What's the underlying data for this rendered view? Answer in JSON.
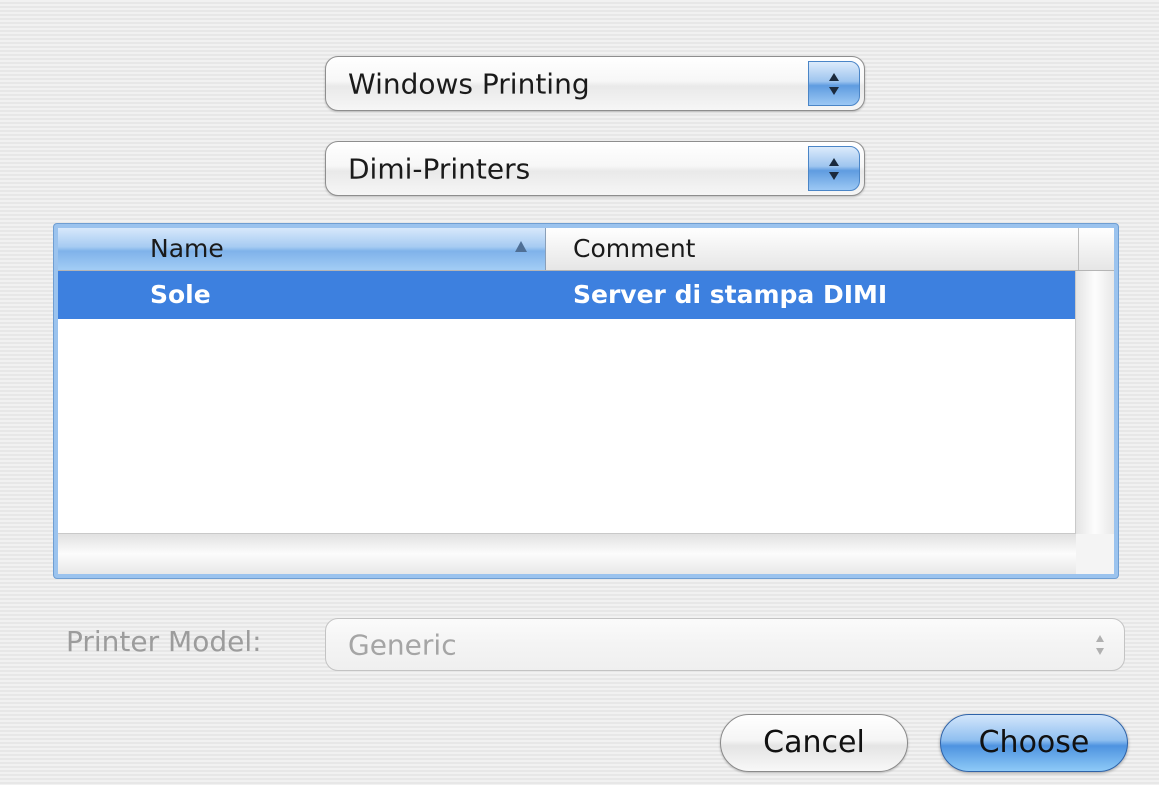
{
  "protocol_popup": {
    "value": "Windows Printing"
  },
  "workgroup_popup": {
    "value": "Dimi-Printers"
  },
  "printer_list": {
    "columns": [
      {
        "label": "Name",
        "sorted": "ascending"
      },
      {
        "label": "Comment"
      }
    ],
    "rows": [
      {
        "name": "Sole",
        "comment": "Server di stampa DIMI",
        "selected": true
      }
    ]
  },
  "printer_model": {
    "label": "Printer Model:",
    "value": "Generic",
    "enabled": false
  },
  "buttons": {
    "cancel": "Cancel",
    "choose": "Choose"
  },
  "colors": {
    "selection": "#3d80df",
    "accent": "#5f9ce0"
  }
}
